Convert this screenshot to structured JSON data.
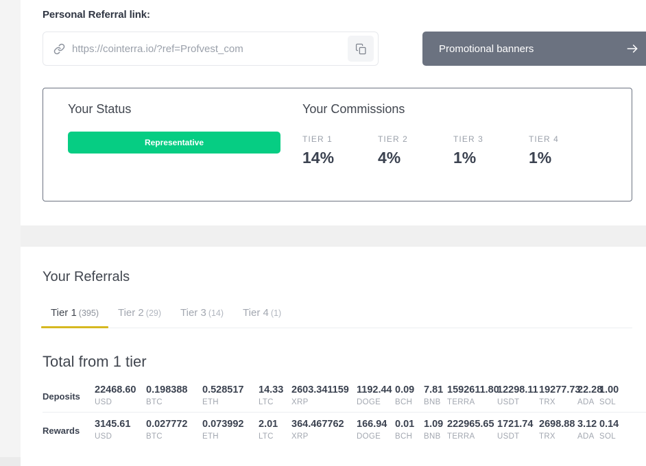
{
  "referral": {
    "heading": "Personal Referral link:",
    "link_value": "https://cointerra.io/?ref=Profvest_com",
    "link_icon": "link-chain-icon",
    "copy_icon": "copy-icon",
    "banner_button_label": "Promotional banners",
    "banner_button_icon": "arrow-right-icon"
  },
  "status": {
    "heading": "Your Status",
    "badge_label": "Representative",
    "badge_color": "#06cd83"
  },
  "commissions": {
    "heading": "Your Commissions",
    "tiers": [
      {
        "label": "TIER 1",
        "value": "14%"
      },
      {
        "label": "TIER 2",
        "value": "4%"
      },
      {
        "label": "TIER 3",
        "value": "1%"
      },
      {
        "label": "TIER 4",
        "value": "1%"
      }
    ]
  },
  "referrals": {
    "heading": "Your Referrals",
    "active_tab_index": 0,
    "accent_color": "#d6b820",
    "tabs": [
      {
        "label": "Tier 1",
        "count": "(395)"
      },
      {
        "label": "Tier 2",
        "count": "(29)"
      },
      {
        "label": "Tier 3",
        "count": "(14)"
      },
      {
        "label": "Tier 4",
        "count": "(1)"
      }
    ],
    "total_heading": "Total from 1 tier",
    "currencies": [
      "USD",
      "BTC",
      "ETH",
      "LTC",
      "XRP",
      "DOGE",
      "BCH",
      "BNB",
      "TERRA",
      "USDT",
      "TRX",
      "ADA",
      "SOL"
    ],
    "rows": [
      {
        "label": "Deposits",
        "values": [
          "22468.60",
          "0.198388",
          "0.528517",
          "14.33",
          "2603.341159",
          "1192.44",
          "0.09",
          "7.81",
          "1592611.80",
          "12298.11",
          "19277.73",
          "22.28",
          "1.00"
        ]
      },
      {
        "label": "Rewards",
        "values": [
          "3145.61",
          "0.027772",
          "0.073992",
          "2.01",
          "364.467762",
          "166.94",
          "0.01",
          "1.09",
          "222965.65",
          "1721.74",
          "2698.88",
          "3.12",
          "0.14"
        ]
      }
    ]
  }
}
